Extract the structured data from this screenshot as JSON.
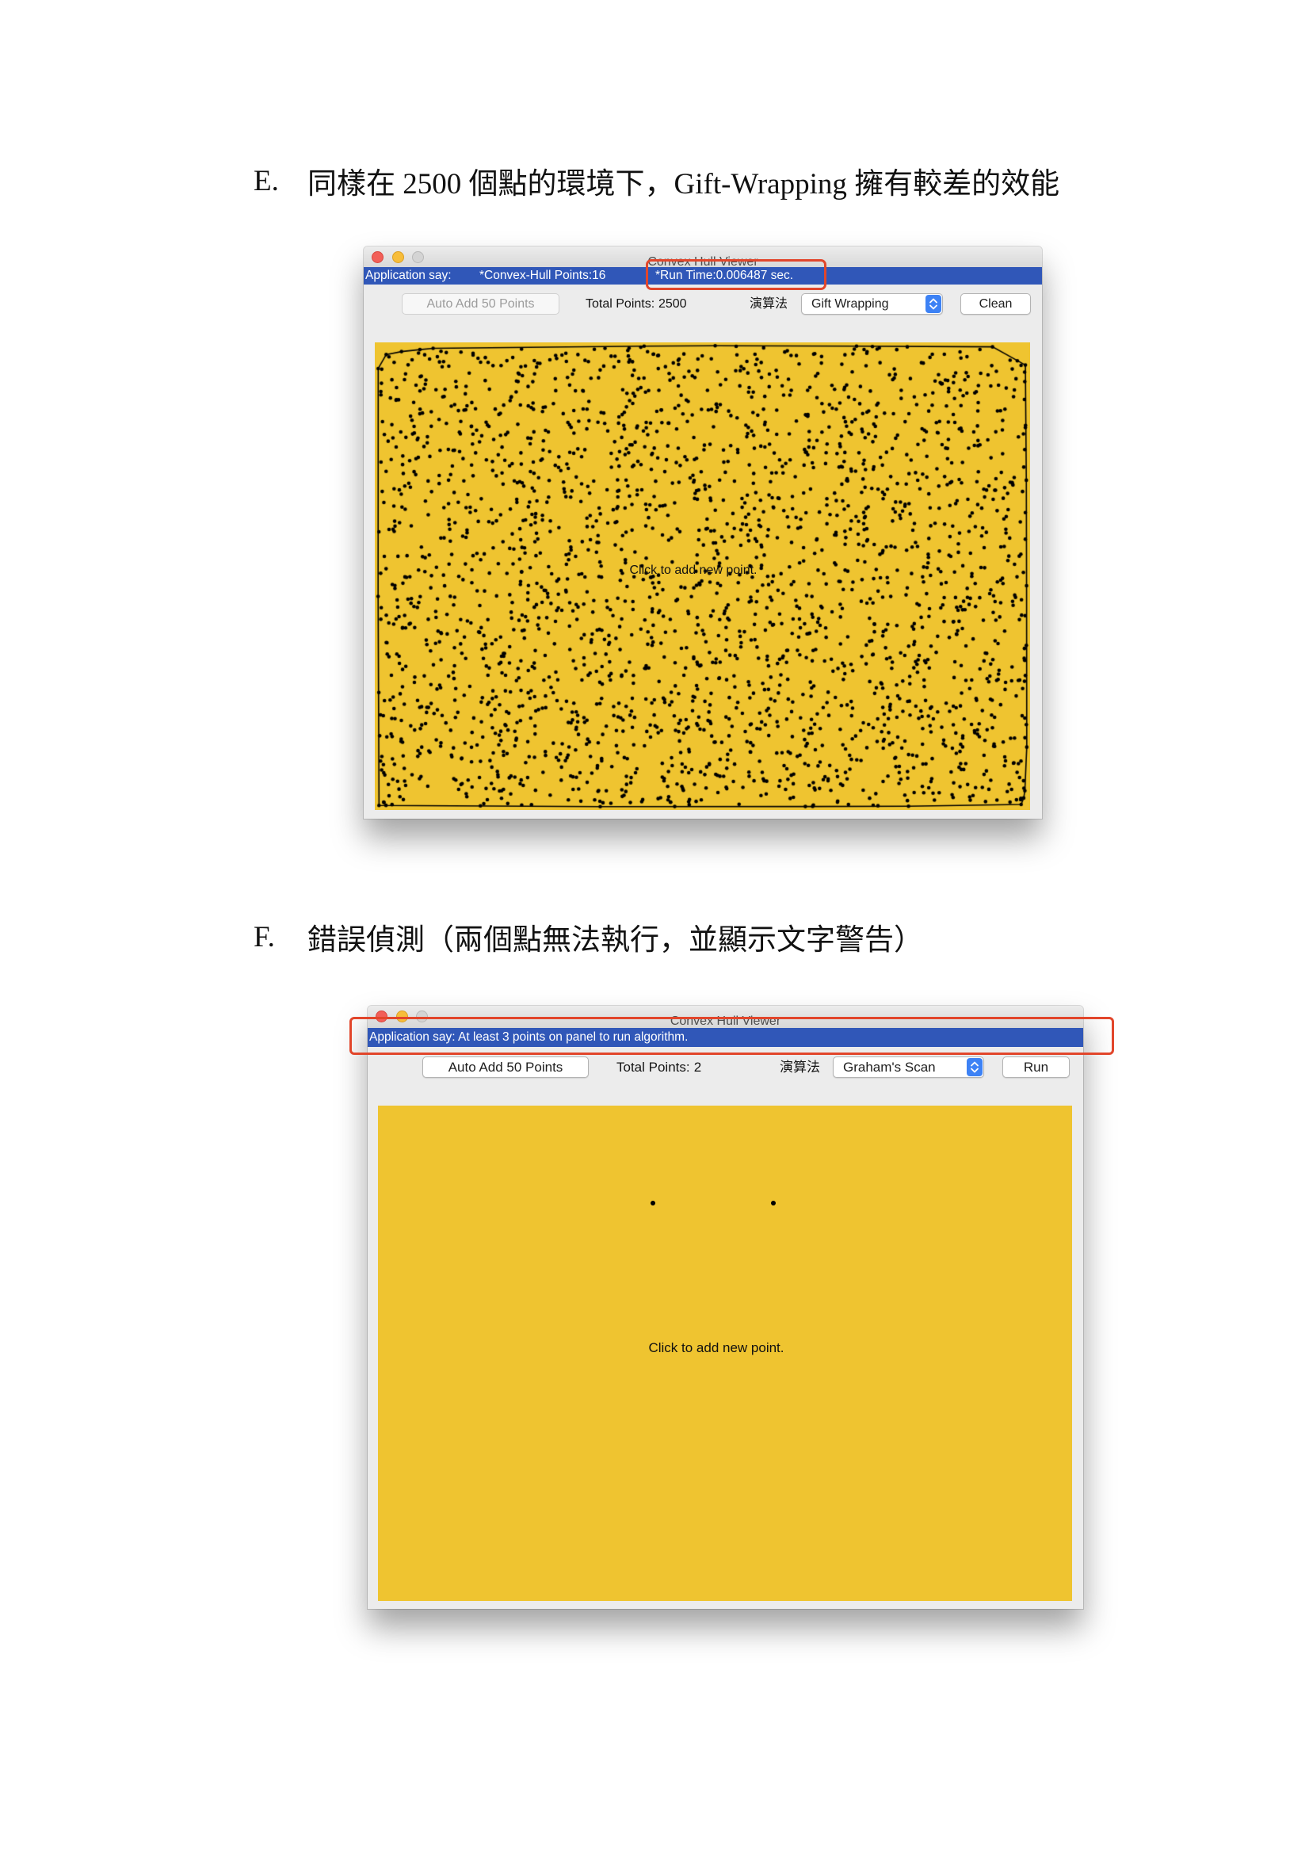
{
  "sections": [
    {
      "letter": "E.",
      "heading": "同樣在 2500 個點的環境下，Gift-Wrapping 擁有較差的效能"
    },
    {
      "letter": "F.",
      "heading": "錯誤偵測（兩個點無法執行，並顯示文字警告）"
    }
  ],
  "colors": {
    "status_bar": "#3057b8",
    "panel": "#efc430",
    "highlight": "#e2462b",
    "point": "#000000",
    "select_stepper": "#3d82f5"
  },
  "window_e": {
    "title": "Convex Hull Viewer",
    "status": {
      "prefix": "Application say:",
      "hull_points": "*Convex-Hull Points:16",
      "run_time": "*Run Time:0.006487 sec."
    },
    "toolbar": {
      "auto_add": "Auto Add 50 Points",
      "auto_add_enabled": false,
      "total_label": "Total Points:",
      "total_points": 2500,
      "algorithm_label": "演算法",
      "algorithm_selected": "Gift Wrapping",
      "action_button": "Clean"
    },
    "panel_hint": "Click to add new point."
  },
  "window_f": {
    "title": "Convex Hull Viewer",
    "status": {
      "message": "Application say: At least 3 points on panel to run algorithm."
    },
    "toolbar": {
      "auto_add": "Auto Add 50 Points",
      "auto_add_enabled": true,
      "total_label": "Total Points:",
      "total_points": 2,
      "algorithm_label": "演算法",
      "algorithm_selected": "Graham's Scan",
      "action_button": "Run"
    },
    "panel_hint": "Click to add new point."
  }
}
